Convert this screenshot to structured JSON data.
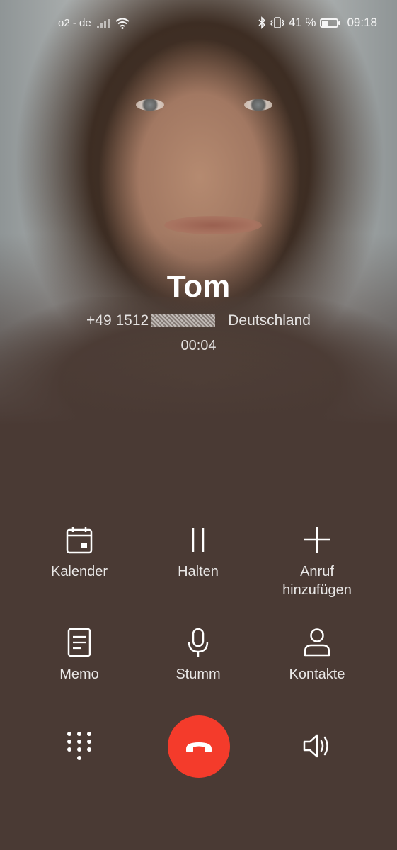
{
  "status_bar": {
    "carrier": "o2 - de",
    "battery_percent": "41 %",
    "battery_level": 0.41,
    "time": "09:18"
  },
  "call": {
    "contact_name": "Tom",
    "number_prefix": "+49 1512",
    "country": "Deutschland",
    "duration": "00:04"
  },
  "controls": {
    "calendar": {
      "label": "Kalender",
      "icon": "calendar-icon"
    },
    "hold": {
      "label": "Halten",
      "icon": "pause-icon"
    },
    "add_call": {
      "label_line1": "Anruf",
      "label_line2": "hinzufügen",
      "icon": "plus-icon"
    },
    "memo": {
      "label": "Memo",
      "icon": "memo-icon"
    },
    "mute": {
      "label": "Stumm",
      "icon": "microphone-icon"
    },
    "contacts": {
      "label": "Kontakte",
      "icon": "person-icon"
    }
  },
  "bottom": {
    "dialpad_icon": "dialpad-icon",
    "end_call_icon": "hang-up-icon",
    "speaker_icon": "speaker-icon",
    "end_call_color": "#f43b2b"
  },
  "colors": {
    "background": "#4a3a34",
    "text": "#ffffff"
  }
}
